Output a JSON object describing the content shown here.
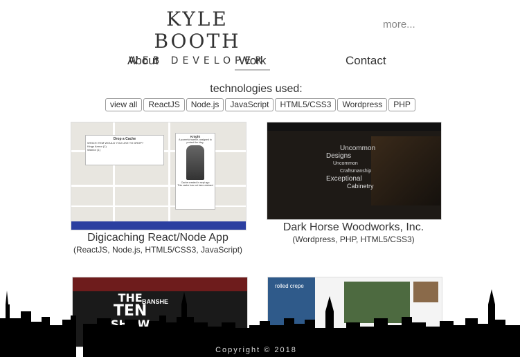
{
  "header": {
    "name": "KYLE BOOTH",
    "subtitle": "WEB DEVELOPER",
    "more": "more..."
  },
  "nav": [
    "About",
    "Work",
    "Contact"
  ],
  "technologies": {
    "title": "technologies used:",
    "filters": [
      "view all",
      "ReactJS",
      "Node.js",
      "JavaScript",
      "HTML5/CSS3",
      "Wordpress",
      "PHP"
    ]
  },
  "projects": [
    {
      "title": "Digicaching React/Node App",
      "tech": "(ReactJS, Node.js, HTML5/CSS3, JavaScript)"
    },
    {
      "title": "Dark Horse Woodworks, Inc.",
      "tech": "(Wordpress, PHP, HTML5/CSS3)"
    }
  ],
  "thumb_text": {
    "modal1_title": "Drop a Cache",
    "modal1_q": "WHICH ITEM WOULD YOU LIKE TO DROP?",
    "modal1_opt1": "Kings Armor (1)",
    "modal1_opt2": "Warrior (1)",
    "modal2_title": "Knight",
    "modal2_desc": "A powerful warrior, assigned to protect the king.",
    "modal2_foot1": "Cache created in sept ago",
    "modal2_foot2": "This cache has not been claimed",
    "woods_line1": "Uncommon",
    "woods_line2": "Designs",
    "woods_line3": "Uncommon",
    "woods_line4": "Craftsmanship",
    "woods_line5": "Exceptional",
    "woods_line6": "Cabinetry",
    "ten_line1": "THE",
    "ten_line2": "TEN",
    "ten_line3": "SHOW",
    "banshe": "BANSHE",
    "rolled": "rolled crepe"
  },
  "footer": {
    "copyright": "Copyright © 2018"
  },
  "colors": {
    "bar": "#2b3fa0",
    "wood_bg": "#1e1a16",
    "ten_bg": "#6e1c1c"
  }
}
